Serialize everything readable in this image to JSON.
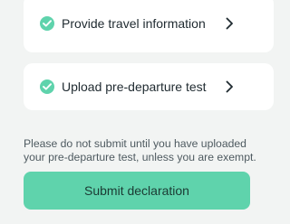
{
  "colors": {
    "background": "#f2f4f3",
    "card": "#ffffff",
    "check": "#5fd3ac",
    "button": "#5fd3ac",
    "text": "#1f2a30",
    "muted_text": "#4e5a60"
  },
  "steps": [
    {
      "label": "Provide travel information",
      "status_icon": "check-circle-icon",
      "action_icon": "chevron-right-icon"
    },
    {
      "label": "Upload pre-departure test",
      "status_icon": "check-circle-icon",
      "action_icon": "chevron-right-icon"
    }
  ],
  "notice": {
    "line1": "Please do not submit until you have uploaded",
    "line2": "your pre-departure test, unless you are exempt."
  },
  "submit": {
    "label": "Submit declaration"
  }
}
